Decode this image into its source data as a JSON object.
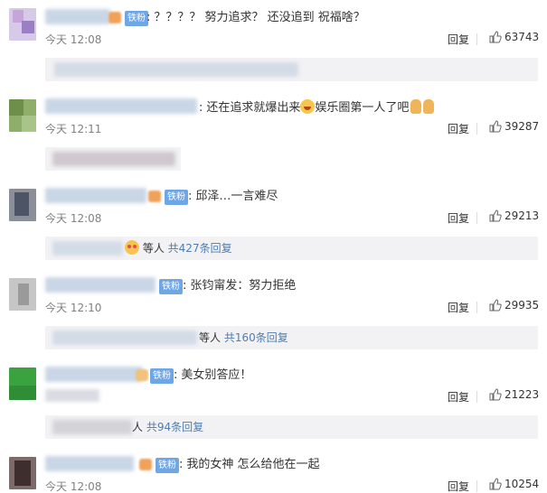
{
  "fan_badge_label": "铁粉",
  "reply_label": "回复",
  "colors": {
    "link": "#507daf",
    "badge": "#6fa6e6",
    "subbox": "#f2f2f5",
    "time": "#808080"
  },
  "comments": [
    {
      "text": "？？？？ 努力追求？ 还没追到 祝福啥？",
      "time": "今天 12:08",
      "likes": "63743",
      "sub_reply": {
        "prefix": "",
        "count_label": ""
      }
    },
    {
      "text": "还在追求就爆出来",
      "text_after": "娱乐圈第一人了吧",
      "time": "今天 12:11",
      "likes": "39287",
      "sub_reply": {
        "prefix": "",
        "count_label": ""
      }
    },
    {
      "text": "邱泽…一言难尽",
      "time": "今天 12:08",
      "likes": "29213",
      "sub_reply": {
        "prefix": "等人",
        "count_label": "共427条回复"
      }
    },
    {
      "text": "张钧甯发：努力拒绝",
      "time": "今天 12:10",
      "likes": "29935",
      "sub_reply": {
        "prefix": "等人",
        "count_label": "共160条回复"
      }
    },
    {
      "text": "美女别答应！",
      "time": "",
      "likes": "21223",
      "sub_reply": {
        "prefix": "人",
        "count_label": "共94条回复"
      }
    },
    {
      "text": "我的女神 怎么给他在一起",
      "time": "今天 12:08",
      "likes": "10254",
      "sub_reply": {
        "prefix": "",
        "count_label": ""
      }
    }
  ]
}
